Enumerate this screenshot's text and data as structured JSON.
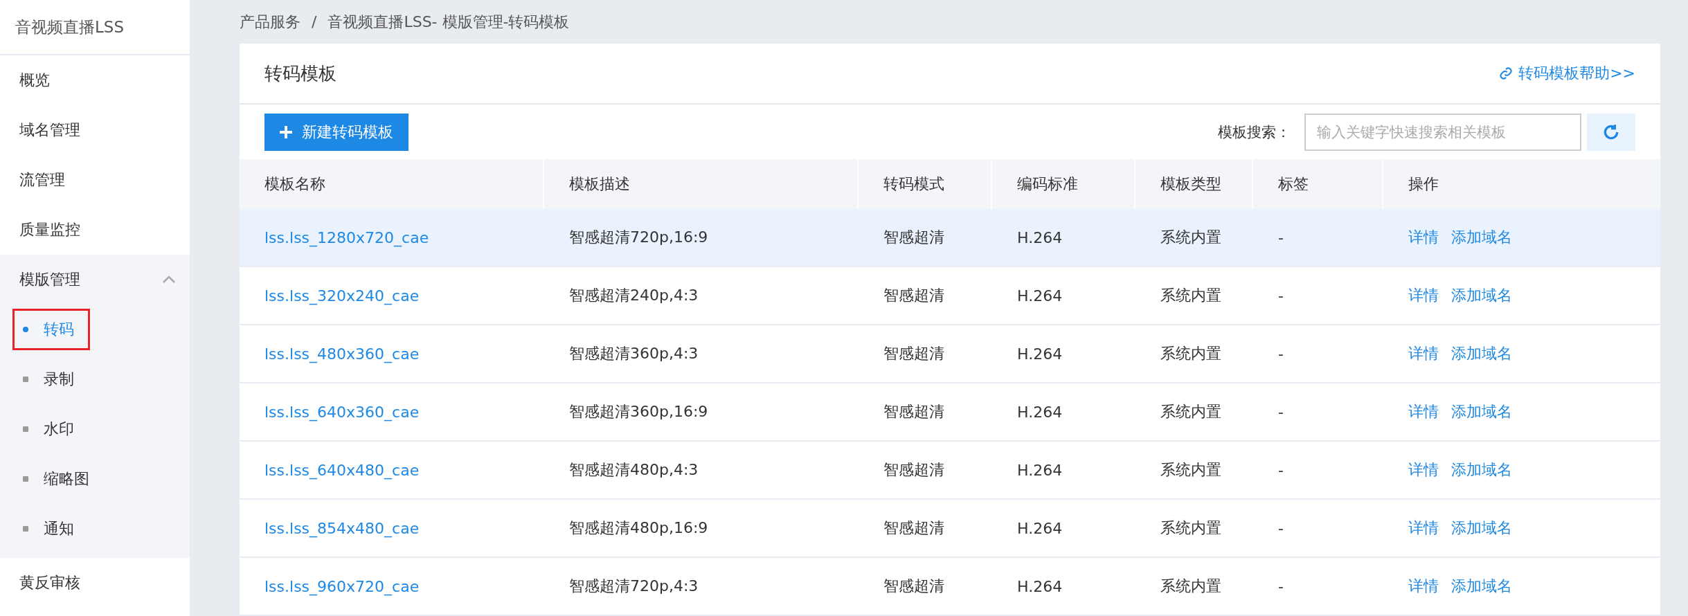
{
  "sidebar": {
    "title": "音视频直播LSS",
    "items": [
      {
        "label": "概览",
        "expanded": false
      },
      {
        "label": "域名管理",
        "expanded": false
      },
      {
        "label": "流管理",
        "expanded": false
      },
      {
        "label": "质量监控",
        "expanded": false
      },
      {
        "label": "模版管理",
        "expanded": true,
        "children": [
          {
            "label": "转码",
            "selected": true,
            "outlined": true
          },
          {
            "label": "录制",
            "selected": false,
            "outlined": false
          },
          {
            "label": "水印",
            "selected": false,
            "outlined": false
          },
          {
            "label": "缩略图",
            "selected": false,
            "outlined": false
          },
          {
            "label": "通知",
            "selected": false,
            "outlined": false
          }
        ]
      },
      {
        "label": "黄反审核",
        "expanded": false
      }
    ]
  },
  "breadcrumb": [
    "产品服务",
    "音视频直播LSS- 模版管理-转码模板"
  ],
  "breadcrumb_separator": "/",
  "card": {
    "title": "转码模板",
    "help_link": "转码模板帮助>>",
    "new_button": "新建转码模板",
    "search_label": "模板搜索：",
    "search": {
      "placeholder": "输入关键字快速搜索相关模板"
    }
  },
  "table": {
    "columns": [
      "模板名称",
      "模板描述",
      "转码模式",
      "编码标准",
      "模板类型",
      "标签",
      "操作"
    ],
    "rows": [
      {
        "name": "lss.lss_1280x720_cae",
        "description": "智感超清720p,16:9",
        "mode": "智感超清",
        "codec": "H.264",
        "type": "系统内置",
        "tag": "-",
        "actions": [
          "详情",
          "添加域名"
        ],
        "selected": true
      },
      {
        "name": "lss.lss_320x240_cae",
        "description": "智感超清240p,4:3",
        "mode": "智感超清",
        "codec": "H.264",
        "type": "系统内置",
        "tag": "-",
        "actions": [
          "详情",
          "添加域名"
        ],
        "selected": false
      },
      {
        "name": "lss.lss_480x360_cae",
        "description": "智感超清360p,4:3",
        "mode": "智感超清",
        "codec": "H.264",
        "type": "系统内置",
        "tag": "-",
        "actions": [
          "详情",
          "添加域名"
        ],
        "selected": false
      },
      {
        "name": "lss.lss_640x360_cae",
        "description": "智感超清360p,16:9",
        "mode": "智感超清",
        "codec": "H.264",
        "type": "系统内置",
        "tag": "-",
        "actions": [
          "详情",
          "添加域名"
        ],
        "selected": false
      },
      {
        "name": "lss.lss_640x480_cae",
        "description": "智感超清480p,4:3",
        "mode": "智感超清",
        "codec": "H.264",
        "type": "系统内置",
        "tag": "-",
        "actions": [
          "详情",
          "添加域名"
        ],
        "selected": false
      },
      {
        "name": "lss.lss_854x480_cae",
        "description": "智感超清480p,16:9",
        "mode": "智感超清",
        "codec": "H.264",
        "type": "系统内置",
        "tag": "-",
        "actions": [
          "详情",
          "添加域名"
        ],
        "selected": false
      },
      {
        "name": "lss.lss_960x720_cae",
        "description": "智感超清720p,4:3",
        "mode": "智感超清",
        "codec": "H.264",
        "type": "系统内置",
        "tag": "-",
        "actions": [
          "详情",
          "添加域名"
        ],
        "selected": false
      }
    ]
  }
}
